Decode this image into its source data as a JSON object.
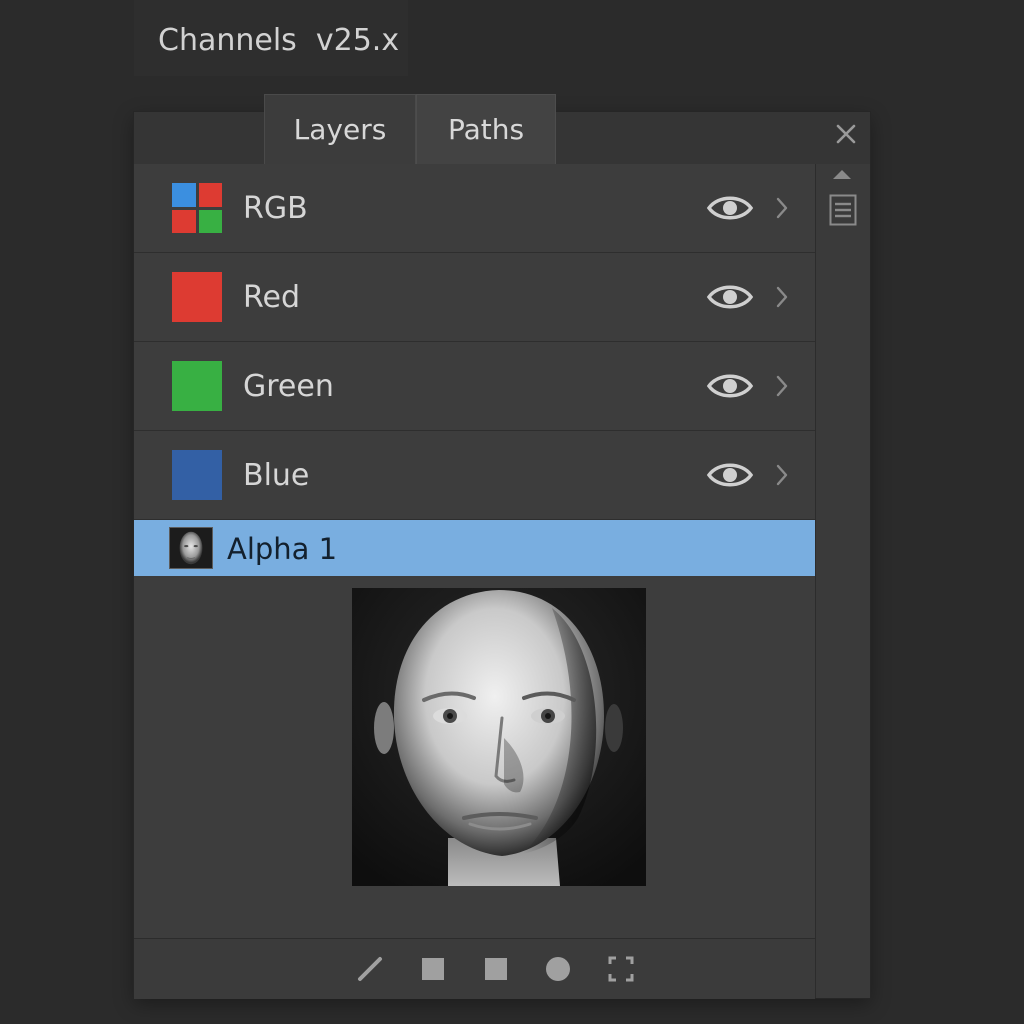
{
  "window": {
    "title": "Channels  v25.x"
  },
  "tabs": [
    {
      "label": "Layers",
      "active": true
    },
    {
      "label": "Paths",
      "active": false
    }
  ],
  "channels": [
    {
      "label": "RGB",
      "icon": "rgb-composite-swatch",
      "visible": true
    },
    {
      "label": "Red",
      "color": "#dd3b32",
      "visible": true
    },
    {
      "label": "Green",
      "color": "#38b043",
      "visible": true
    },
    {
      "label": "Blue",
      "color": "#3360a5",
      "visible": true
    }
  ],
  "alpha_channel": {
    "label": "Alpha 1",
    "selected": true,
    "highlight_color": "#79aee0"
  },
  "icons": {
    "close": "close-icon",
    "panel_menu": "hamburger-menu-icon",
    "eye": "eye-icon",
    "chevron": "chevron-right-icon",
    "bottom_tools": [
      "brush-icon",
      "square-icon",
      "square-icon",
      "circle-icon",
      "dashed-selection-icon"
    ]
  }
}
